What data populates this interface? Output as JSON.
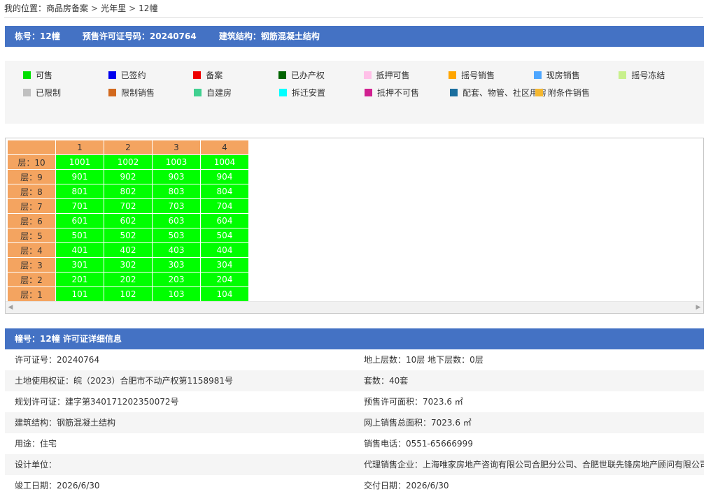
{
  "breadcrumb": {
    "prefix": "我的位置：",
    "items": [
      "商品房备案",
      "光年里",
      "12幢"
    ],
    "separator": ">"
  },
  "header": {
    "building": "栋号：12幢",
    "permit": "预售许可证号码：20240764",
    "structure": "建筑结构：钢筋混凝土结构"
  },
  "legend": [
    {
      "label": "可售",
      "color": "#00e000"
    },
    {
      "label": "已签约",
      "color": "#0000ee"
    },
    {
      "label": "备案",
      "color": "#ee0000"
    },
    {
      "label": "已办产权",
      "color": "#006400"
    },
    {
      "label": "抵押可售",
      "color": "#ffc0e8"
    },
    {
      "label": "摇号销售",
      "color": "#ffa500"
    },
    {
      "label": "现房销售",
      "color": "#4da6ff"
    },
    {
      "label": "摇号冻结",
      "color": "#c8f08c"
    },
    {
      "label": "已限制",
      "color": "#c0c0c0"
    },
    {
      "label": "限制销售",
      "color": "#d2691e"
    },
    {
      "label": "自建房",
      "color": "#40d090"
    },
    {
      "label": "拆迁安置",
      "color": "#00ffff"
    },
    {
      "label": "抵押不可售",
      "color": "#d02090"
    },
    {
      "label": "配套、物管、社区用房",
      "color": "#1a6e9e"
    },
    {
      "label": "附条件销售",
      "color": "#f5b830"
    }
  ],
  "grid": {
    "columns": [
      "1",
      "2",
      "3",
      "4"
    ],
    "rows": [
      {
        "floor": "层：10",
        "units": [
          "1001",
          "1002",
          "1003",
          "1004"
        ]
      },
      {
        "floor": "层：9",
        "units": [
          "901",
          "902",
          "903",
          "904"
        ]
      },
      {
        "floor": "层：8",
        "units": [
          "801",
          "802",
          "803",
          "804"
        ]
      },
      {
        "floor": "层：7",
        "units": [
          "701",
          "702",
          "703",
          "704"
        ]
      },
      {
        "floor": "层：6",
        "units": [
          "601",
          "602",
          "603",
          "604"
        ]
      },
      {
        "floor": "层：5",
        "units": [
          "501",
          "502",
          "503",
          "504"
        ]
      },
      {
        "floor": "层：4",
        "units": [
          "401",
          "402",
          "403",
          "404"
        ]
      },
      {
        "floor": "层：3",
        "units": [
          "301",
          "302",
          "303",
          "304"
        ]
      },
      {
        "floor": "层：2",
        "units": [
          "201",
          "202",
          "203",
          "204"
        ]
      },
      {
        "floor": "层：1",
        "units": [
          "101",
          "102",
          "103",
          "104"
        ]
      }
    ],
    "colors": {
      "header": "#f4a460",
      "available": "#00ff00"
    }
  },
  "details": {
    "title": "幢号：12幢 许可证详细信息",
    "rows": [
      [
        "许可证号：20240764",
        "地上层数：10层  地下层数：0层"
      ],
      [
        "土地使用权证：皖（2023）合肥市不动产权第1158981号",
        "套数：40套"
      ],
      [
        "规划许可证：建字第340171202350072号",
        "预售许可面积：7023.6 ㎡"
      ],
      [
        "建筑结构：钢筋混凝土结构",
        "网上销售总面积：7023.6 ㎡"
      ],
      [
        "用途：住宅",
        "销售电话：0551-65666999"
      ],
      [
        "设计单位：",
        "代理销售企业：上海唯家房地产咨询有限公司合肥分公司、合肥世联先锋房地产顾问有限公司"
      ],
      [
        "竣工日期：2026/6/30",
        "交付日期：2026/6/30"
      ]
    ]
  },
  "accent_color": "#4472c4"
}
